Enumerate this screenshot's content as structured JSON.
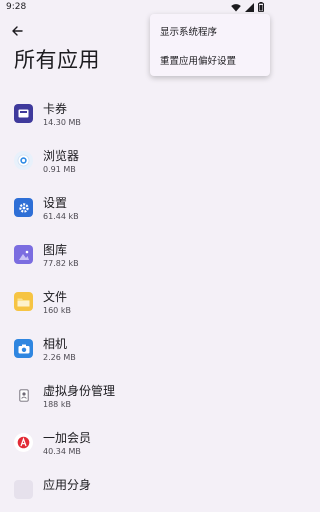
{
  "status_bar": {
    "time": "9:28"
  },
  "page_title": "所有应用",
  "overflow_menu": {
    "items": [
      "显示系统程序",
      "重置应用偏好设置"
    ]
  },
  "apps": [
    {
      "name": "卡券",
      "size": "14.30 MB",
      "icon": "wallet-icon"
    },
    {
      "name": "浏览器",
      "size": "0.91 MB",
      "icon": "browser-icon"
    },
    {
      "name": "设置",
      "size": "61.44 kB",
      "icon": "settings-gear-icon"
    },
    {
      "name": "图库",
      "size": "77.82 kB",
      "icon": "gallery-icon"
    },
    {
      "name": "文件",
      "size": "160 kB",
      "icon": "folder-icon"
    },
    {
      "name": "相机",
      "size": "2.26 MB",
      "icon": "camera-icon"
    },
    {
      "name": "虚拟身份管理",
      "size": "188 kB",
      "icon": "virtual-identity-icon"
    },
    {
      "name": "一加会员",
      "size": "40.34 MB",
      "icon": "oneplus-member-icon"
    },
    {
      "name": "应用分身",
      "size": "",
      "icon": "app-clone-icon"
    }
  ]
}
